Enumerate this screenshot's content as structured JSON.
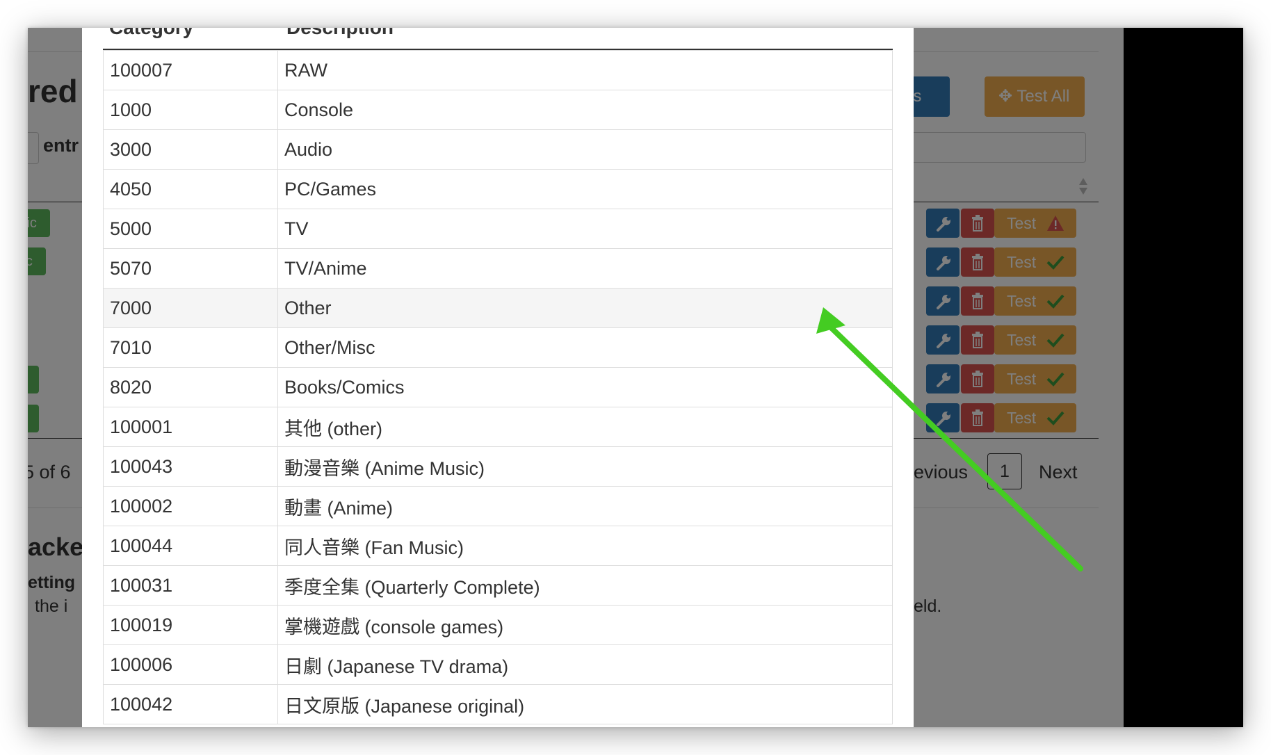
{
  "background": {
    "title_fragment": "red",
    "entries_fragment": "entr",
    "tag_fragments": [
      "lic",
      "lic",
      "c",
      "c"
    ],
    "pagination_text_fragment": "5 of 6",
    "section_heading_fragment": "acke",
    "settings_fragment": "etting",
    "help_fragment": "the i",
    "help_tail_fragment": "eld.",
    "releases_button_fragment": "leases",
    "test_all_button": "Test All",
    "test_button_label": "Test",
    "previous_fragment": "evious",
    "page_number": "1",
    "next_fragment": "Next",
    "colors": {
      "primary": "#337ab7",
      "danger": "#d9534f",
      "warning": "#f0ad4e",
      "success": "#5cb85c"
    }
  },
  "modal": {
    "headers": {
      "category": "Category",
      "description": "Description"
    },
    "rows": [
      {
        "category": "100007",
        "description": "RAW"
      },
      {
        "category": "1000",
        "description": "Console"
      },
      {
        "category": "3000",
        "description": "Audio"
      },
      {
        "category": "4050",
        "description": "PC/Games"
      },
      {
        "category": "5000",
        "description": "TV"
      },
      {
        "category": "5070",
        "description": "TV/Anime"
      },
      {
        "category": "7000",
        "description": "Other"
      },
      {
        "category": "7010",
        "description": "Other/Misc"
      },
      {
        "category": "8020",
        "description": "Books/Comics"
      },
      {
        "category": "100001",
        "description": "其他 (other)"
      },
      {
        "category": "100043",
        "description": "動漫音樂 (Anime Music)"
      },
      {
        "category": "100002",
        "description": "動畫 (Anime)"
      },
      {
        "category": "100044",
        "description": "同人音樂 (Fan Music)"
      },
      {
        "category": "100031",
        "description": "季度全集 (Quarterly Complete)"
      },
      {
        "category": "100019",
        "description": "掌機遊戲 (console games)"
      },
      {
        "category": "100006",
        "description": "日劇 (Japanese TV drama)"
      },
      {
        "category": "100042",
        "description": "日文原版 (Japanese original)"
      }
    ]
  },
  "icons": {
    "configure": "wrench-icon",
    "delete": "trash-icon",
    "warning": "warning-triangle-icon",
    "success": "checkmark-icon",
    "test_all": "crosshair-icon",
    "sort": "sort-arrows-icon"
  },
  "annotation_arrow_color": "#44cc22"
}
